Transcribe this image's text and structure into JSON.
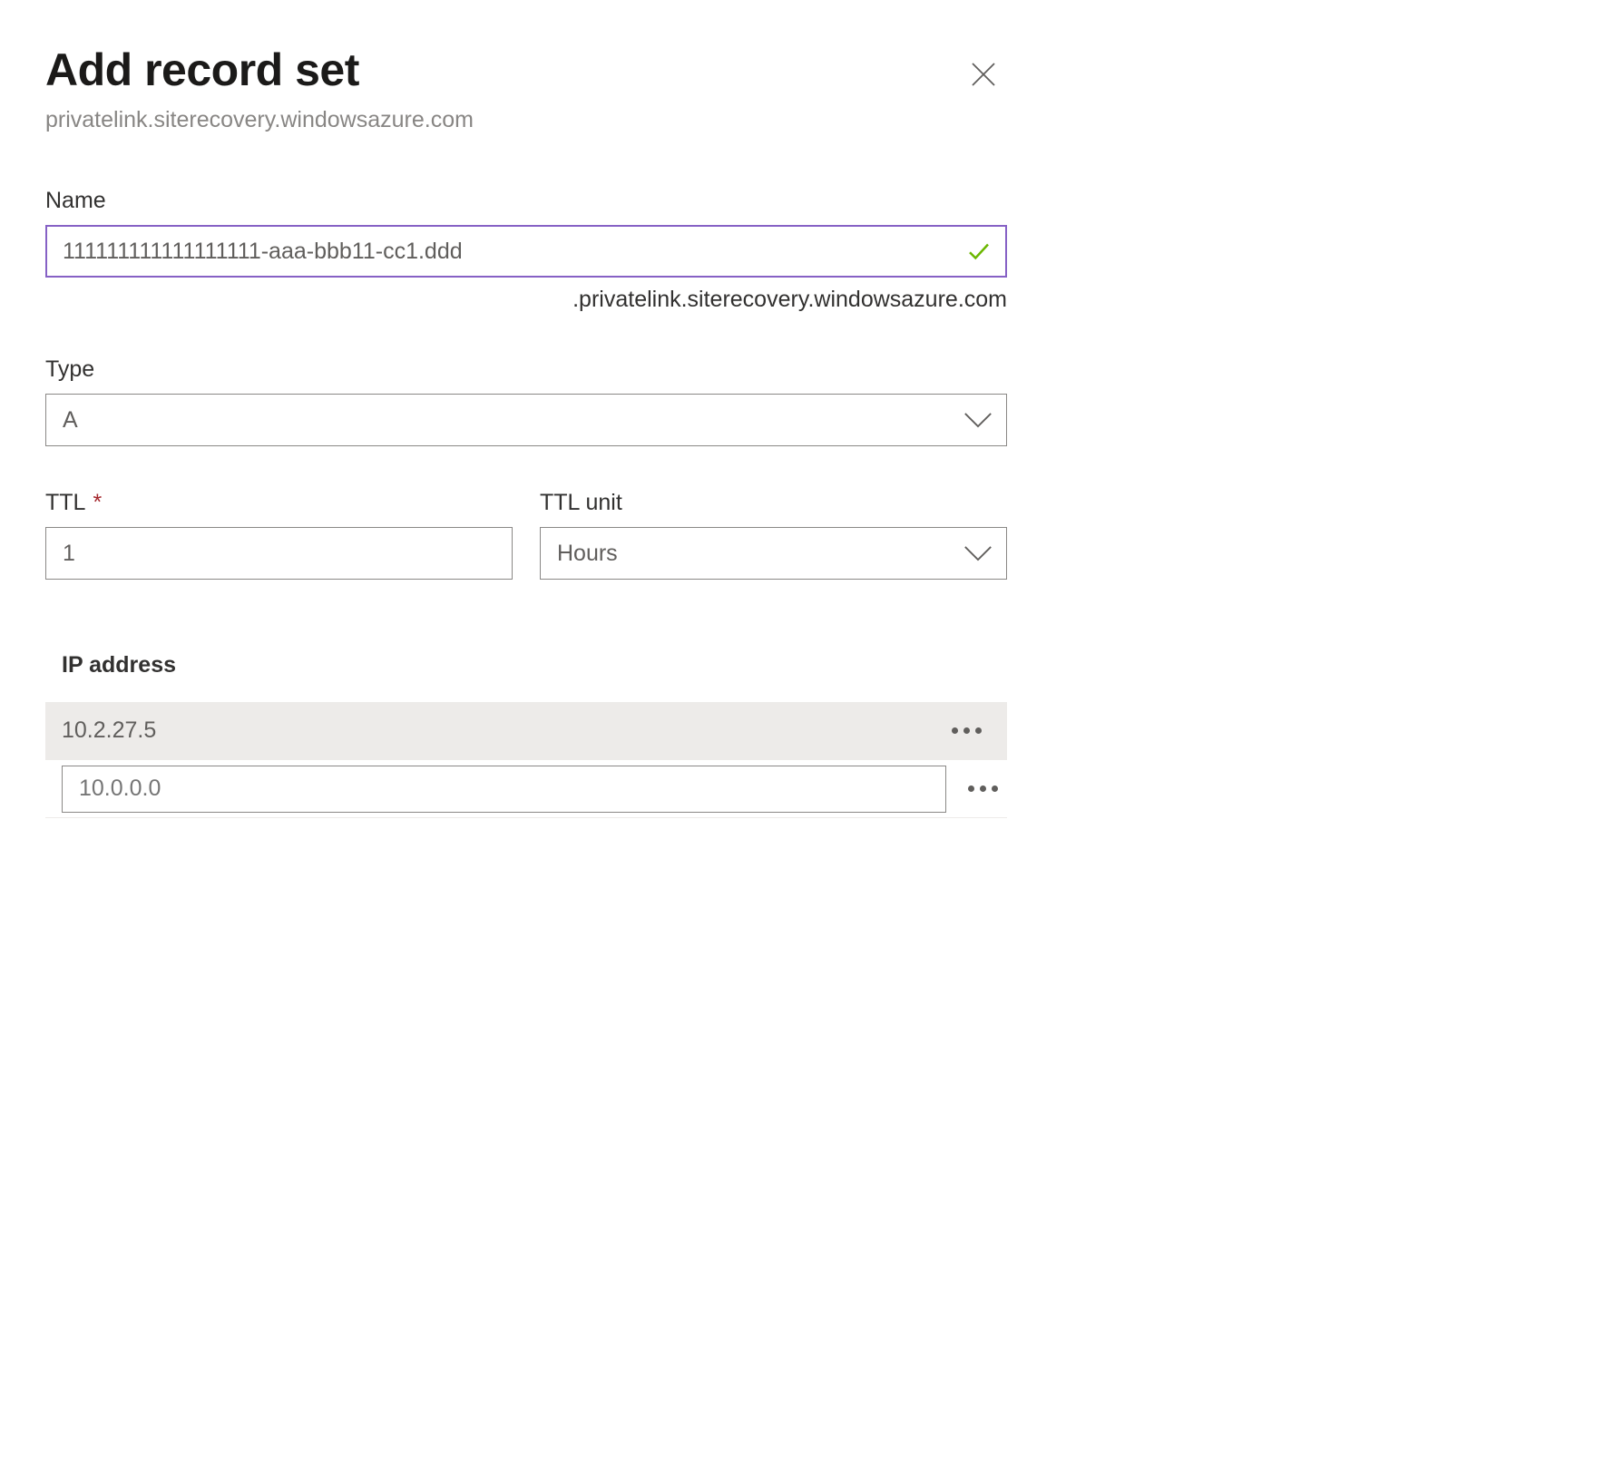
{
  "header": {
    "title": "Add record set",
    "subtitle": "privatelink.siterecovery.windowsazure.com"
  },
  "form": {
    "name": {
      "label": "Name",
      "value": "111111111111111111-aaa-bbb11-cc1.ddd",
      "suffix": ".privatelink.siterecovery.windowsazure.com"
    },
    "type": {
      "label": "Type",
      "value": "A"
    },
    "ttl": {
      "label": "TTL",
      "required_marker": "*",
      "value": "1"
    },
    "ttl_unit": {
      "label": "TTL unit",
      "value": "Hours"
    }
  },
  "ip_section": {
    "heading": "IP address",
    "rows": [
      {
        "value": "10.2.27.5"
      }
    ],
    "new_placeholder": "10.0.0.0"
  }
}
